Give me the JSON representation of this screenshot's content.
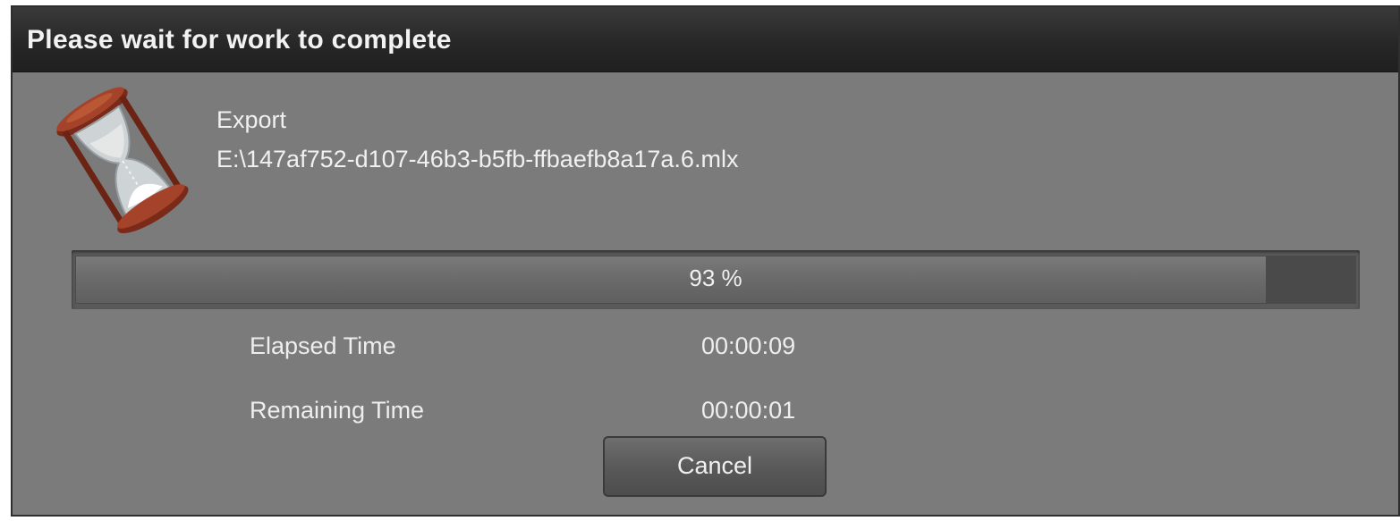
{
  "dialog": {
    "title": "Please wait for work to complete",
    "icon": "hourglass-icon"
  },
  "task": {
    "operation": "Export",
    "file_path": "E:\\147af752-d107-46b3-b5fb-ffbaefb8a17a.6.mlx"
  },
  "progress": {
    "percent": 93,
    "label": "93 %"
  },
  "times": {
    "elapsed_label": "Elapsed Time",
    "elapsed_value": "00:00:09",
    "remaining_label": "Remaining Time",
    "remaining_value": "00:00:01"
  },
  "buttons": {
    "cancel": "Cancel"
  }
}
